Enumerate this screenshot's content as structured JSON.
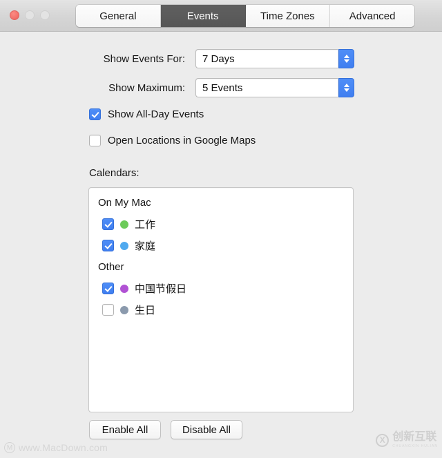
{
  "window": {
    "traffic_lights": [
      {
        "name": "close",
        "state": "active"
      },
      {
        "name": "minimize",
        "state": "disabled"
      },
      {
        "name": "zoom",
        "state": "disabled"
      }
    ]
  },
  "tabs": {
    "selected": "Events",
    "items": [
      {
        "label": "General"
      },
      {
        "label": "Events"
      },
      {
        "label": "Time Zones"
      },
      {
        "label": "Advanced"
      }
    ]
  },
  "settings": {
    "show_events_for": {
      "label": "Show Events For:",
      "value": "7 Days"
    },
    "show_maximum": {
      "label": "Show Maximum:",
      "value": "5 Events"
    },
    "show_all_day_events": {
      "label": "Show All-Day Events",
      "checked": true
    },
    "open_locations_google_maps": {
      "label": "Open Locations in Google Maps",
      "checked": false
    }
  },
  "calendars": {
    "label": "Calendars:",
    "groups": [
      {
        "name": "On My Mac",
        "items": [
          {
            "name": "工作",
            "color": "#6ccb5a",
            "checked": true
          },
          {
            "name": "家庭",
            "color": "#4fa9ef",
            "checked": true
          }
        ]
      },
      {
        "name": "Other",
        "items": [
          {
            "name": "中国节假日",
            "color": "#b152d4",
            "checked": true
          },
          {
            "name": "生日",
            "color": "#8b9aad",
            "checked": false
          }
        ]
      }
    ]
  },
  "buttons": {
    "enable_all": "Enable All",
    "disable_all": "Disable All"
  },
  "watermarks": {
    "left": {
      "logo": "M",
      "text": "www.MacDown.com"
    },
    "right": {
      "logo": "X",
      "text": "创新互联",
      "subtext": "CHUANGXIN HULIAN"
    }
  },
  "colors": {
    "accent": "#4f8ef7",
    "window_bg": "#ececec",
    "selected_tab_bg": "#565656"
  }
}
